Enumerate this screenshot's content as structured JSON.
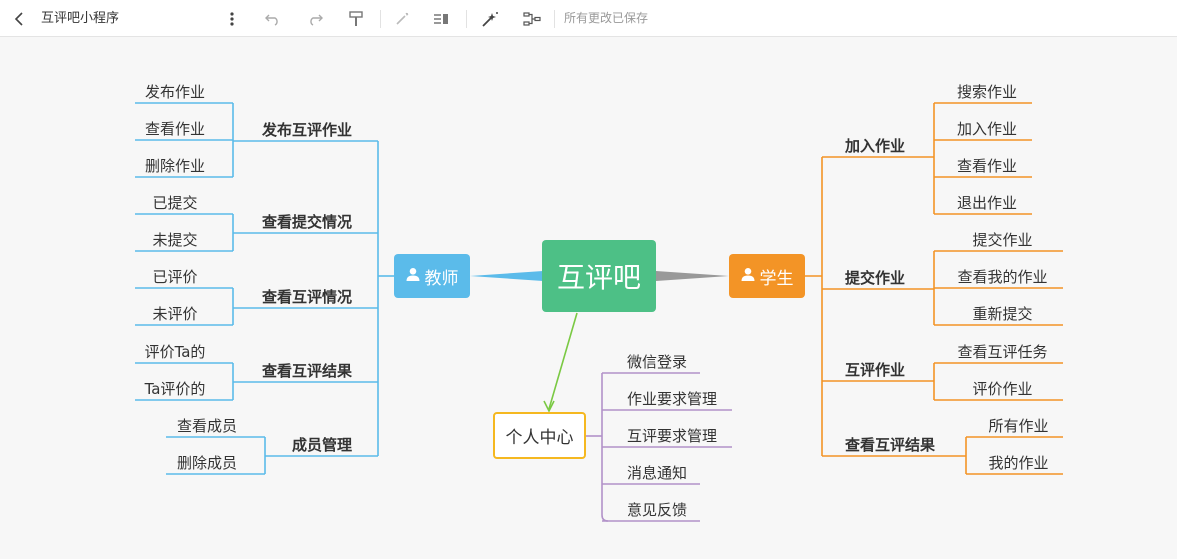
{
  "toolbar": {
    "title": "互评吧小程序",
    "saved_status": "所有更改已保存",
    "icons": [
      "back-icon",
      "more-icon",
      "undo-icon",
      "redo-icon",
      "format-painter-icon",
      "magic-wand-icon",
      "layout-icon",
      "sparkle-icon",
      "structure-icon"
    ]
  },
  "mindmap": {
    "root": "互评吧",
    "teacher": {
      "label": "教师",
      "branches": [
        {
          "label": "发布互评作业",
          "leaves": [
            "发布作业",
            "查看作业",
            "删除作业"
          ]
        },
        {
          "label": "查看提交情况",
          "leaves": [
            "已提交",
            "未提交"
          ]
        },
        {
          "label": "查看互评情况",
          "leaves": [
            "已评价",
            "未评价"
          ]
        },
        {
          "label": "查看互评结果",
          "leaves": [
            "评价Ta的",
            "Ta评价的"
          ]
        },
        {
          "label": "成员管理",
          "leaves": [
            "查看成员",
            "删除成员"
          ]
        }
      ]
    },
    "student": {
      "label": "学生",
      "branches": [
        {
          "label": "加入作业",
          "leaves": [
            "搜索作业",
            "加入作业",
            "查看作业",
            "退出作业"
          ]
        },
        {
          "label": "提交作业",
          "leaves": [
            "提交作业",
            "查看我的作业",
            "重新提交"
          ]
        },
        {
          "label": "互评作业",
          "leaves": [
            "查看互评任务",
            "评价作业"
          ]
        },
        {
          "label": "查看互评结果",
          "leaves": [
            "所有作业",
            "我的作业"
          ]
        }
      ]
    },
    "personal": {
      "label": "个人中心",
      "leaves": [
        "微信登录",
        "作业要求管理",
        "互评要求管理",
        "消息通知",
        "意见反馈"
      ]
    }
  },
  "colors": {
    "root": "#4dc086",
    "teacher": "#5bbbea",
    "student": "#f39426",
    "personal": "#b292c9",
    "personal_border": "#f5b820",
    "arrow": "#7ac943"
  }
}
